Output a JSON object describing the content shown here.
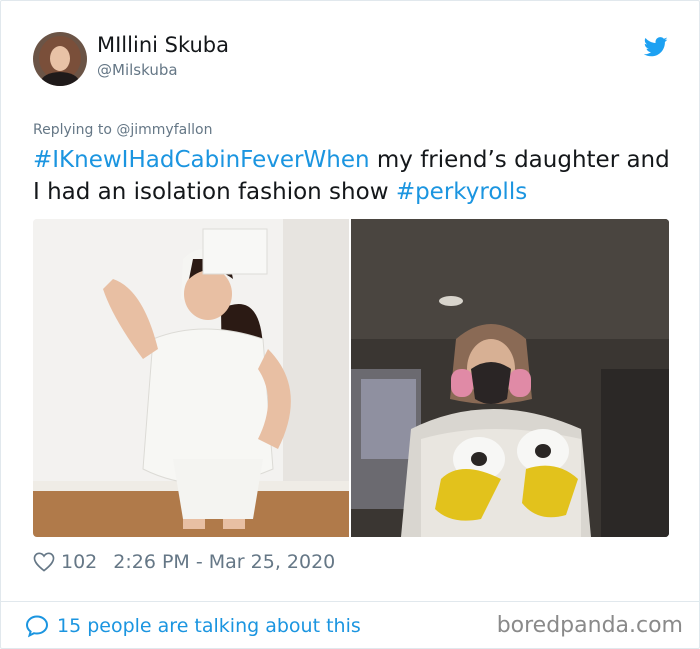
{
  "author": {
    "display_name": "MIllini Skuba",
    "handle": "@Milskuba"
  },
  "tweet": {
    "replying_to": "Replying to @jimmyfallon",
    "hashtag1": "#IKnewIHadCabinFeverWhen",
    "text1": " my friend’s daughter and I had an isolation fashion show ",
    "hashtag2": "#perkyrolls"
  },
  "stats": {
    "likes": "102",
    "timestamp": "2:26 PM - Mar 25, 2020"
  },
  "footer": {
    "talking": "15 people are talking about this",
    "watermark": "boredpanda.com"
  },
  "colors": {
    "link_blue": "#1b95e0",
    "twitter_blue": "#1da1f2",
    "muted_gray": "#657786",
    "text": "#14171a"
  },
  "icons": [
    "twitter-bird-icon",
    "heart-icon",
    "speech-bubble-icon"
  ]
}
